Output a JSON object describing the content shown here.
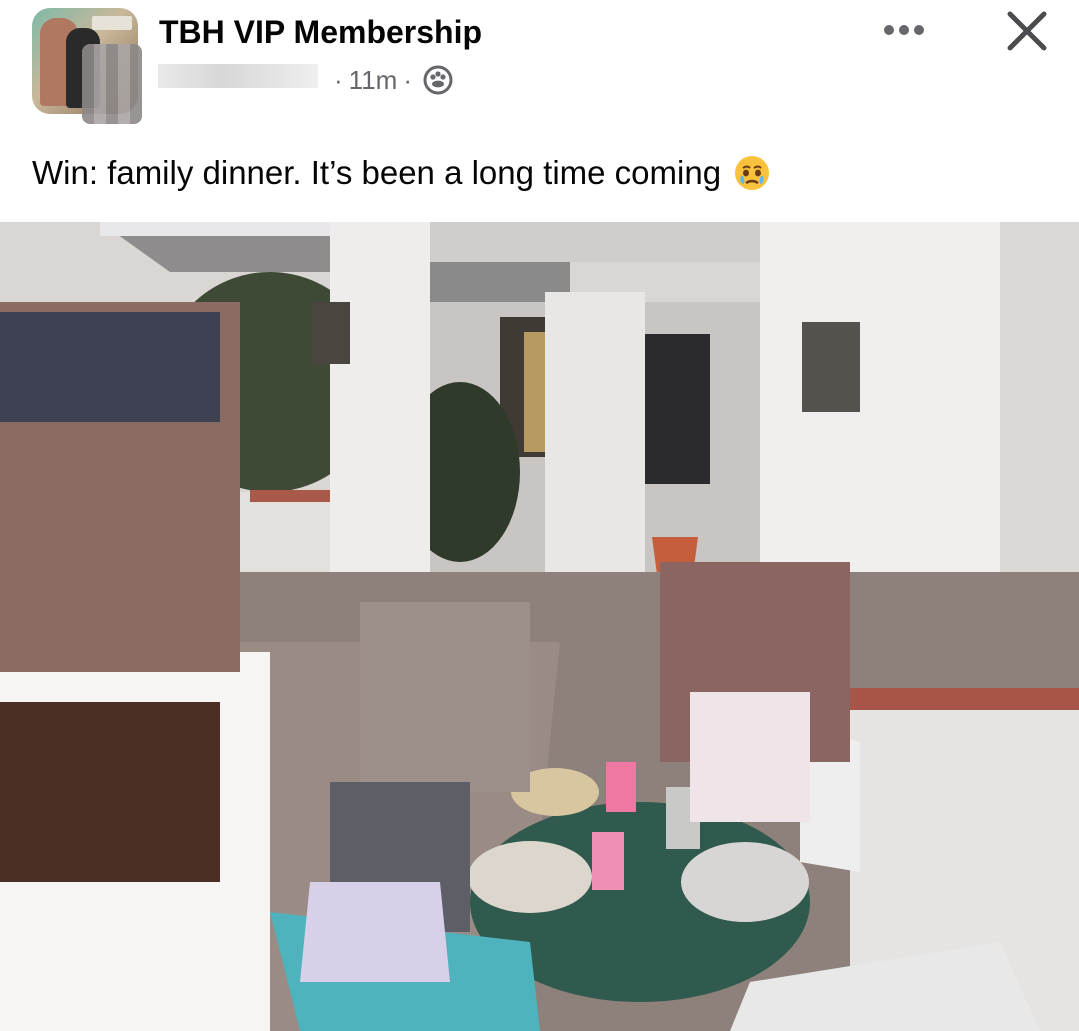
{
  "post": {
    "group_name": "TBH VIP Membership",
    "time": "11m",
    "separator": "·",
    "caption": "Win: family dinner. It’s been a long time coming",
    "icons": {
      "audience": "members-icon",
      "emoji": "face-holding-back-tears-icon",
      "more": "more-horizontal-icon",
      "close": "close-icon"
    }
  }
}
